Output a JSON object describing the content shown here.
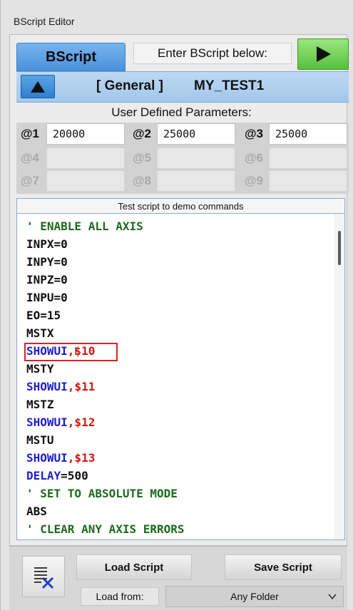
{
  "window": {
    "title": "BScript Editor"
  },
  "header": {
    "tab_label": "BScript",
    "instruction": "Enter BScript below:",
    "run_icon": "play-icon",
    "run_icon_color": "#111111",
    "run_color": "#56c13a"
  },
  "script_bar": {
    "up_icon": "arrow-up-icon",
    "category": "[ General ]",
    "script_name": "MY_TEST1"
  },
  "parameters": {
    "title": "User Defined Parameters:",
    "items": [
      {
        "label": "@1",
        "value": "20000",
        "enabled": true
      },
      {
        "label": "@2",
        "value": "25000",
        "enabled": true
      },
      {
        "label": "@3",
        "value": "25000",
        "enabled": true
      },
      {
        "label": "@4",
        "value": "",
        "enabled": false
      },
      {
        "label": "@5",
        "value": "",
        "enabled": false
      },
      {
        "label": "@6",
        "value": "",
        "enabled": false
      },
      {
        "label": "@7",
        "value": "",
        "enabled": false
      },
      {
        "label": "@8",
        "value": "",
        "enabled": false
      },
      {
        "label": "@9",
        "value": "",
        "enabled": false
      }
    ]
  },
  "script": {
    "description": "Test script to demo commands",
    "lines": [
      {
        "parts": [
          {
            "text": "' ENABLE ALL AXIS",
            "color": "green"
          }
        ]
      },
      {
        "parts": [
          {
            "text": "INPX=0",
            "color": "black"
          }
        ]
      },
      {
        "parts": [
          {
            "text": "INPY=0",
            "color": "black"
          }
        ]
      },
      {
        "parts": [
          {
            "text": "INPZ=0",
            "color": "black"
          }
        ]
      },
      {
        "parts": [
          {
            "text": "INPU=0",
            "color": "black"
          }
        ]
      },
      {
        "parts": [
          {
            "text": "EO=15",
            "color": "black"
          }
        ]
      },
      {
        "parts": [
          {
            "text": "MSTX",
            "color": "black"
          }
        ]
      },
      {
        "parts": [
          {
            "text": "SHOWUI",
            "color": "blue"
          },
          {
            "text": ",$10",
            "color": "red"
          }
        ]
      },
      {
        "parts": [
          {
            "text": "MSTY",
            "color": "black"
          }
        ]
      },
      {
        "parts": [
          {
            "text": "SHOWUI",
            "color": "blue"
          },
          {
            "text": ",$11",
            "color": "red"
          }
        ]
      },
      {
        "parts": [
          {
            "text": "MSTZ",
            "color": "black"
          }
        ]
      },
      {
        "parts": [
          {
            "text": "SHOWUI",
            "color": "blue"
          },
          {
            "text": ",$12",
            "color": "red"
          }
        ]
      },
      {
        "parts": [
          {
            "text": "MSTU",
            "color": "black"
          }
        ]
      },
      {
        "parts": [
          {
            "text": "SHOWUI",
            "color": "blue"
          },
          {
            "text": ",$13",
            "color": "red"
          }
        ]
      },
      {
        "parts": [
          {
            "text": "DELAY",
            "color": "blue"
          },
          {
            "text": "=500",
            "color": "black"
          }
        ]
      },
      {
        "parts": [
          {
            "text": "' SET TO ABSOLUTE MODE",
            "color": "green"
          }
        ]
      },
      {
        "parts": [
          {
            "text": "ABS",
            "color": "black"
          }
        ]
      },
      {
        "parts": [
          {
            "text": "' CLEAR ANY AXIS ERRORS",
            "color": "green"
          }
        ]
      }
    ],
    "highlighted_line": 7
  },
  "footer": {
    "clear_icon": "clear-script-icon",
    "load_label": "Load Script",
    "save_label": "Save Script",
    "load_from_label": "Load from:",
    "folder_value": "Any Folder"
  }
}
